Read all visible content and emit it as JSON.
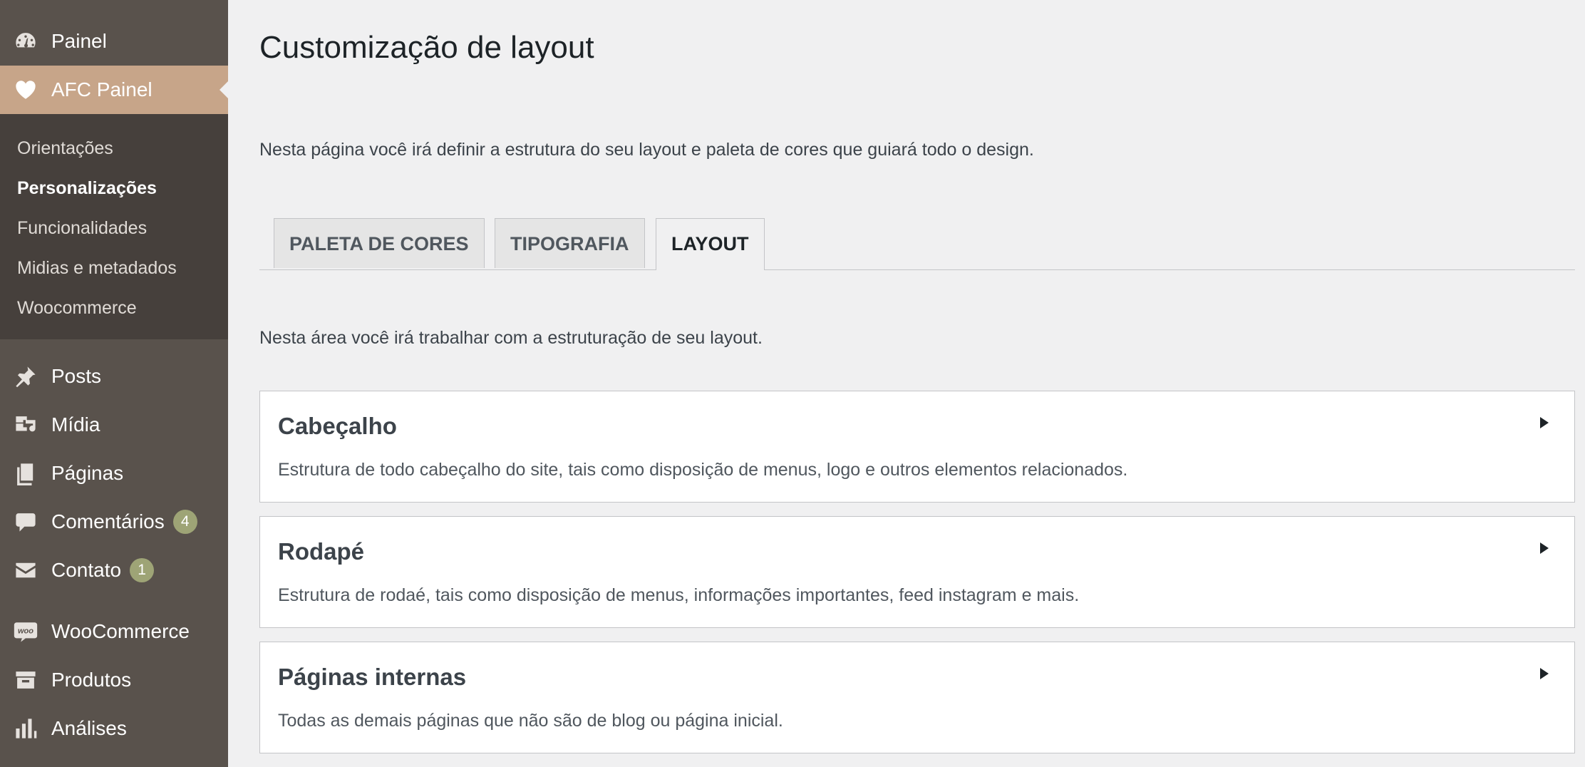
{
  "sidebar": {
    "top": [
      {
        "label": "Painel",
        "icon": "dashboard-icon"
      },
      {
        "label": "AFC Painel",
        "icon": "heart-icon"
      }
    ],
    "submenu": [
      {
        "label": "Orientações"
      },
      {
        "label": "Personalizações"
      },
      {
        "label": "Funcionalidades"
      },
      {
        "label": "Midias e metadados"
      },
      {
        "label": "Woocommerce"
      }
    ],
    "items": [
      {
        "label": "Posts",
        "icon": "pin-icon"
      },
      {
        "label": "Mídia",
        "icon": "media-icon"
      },
      {
        "label": "Páginas",
        "icon": "pages-icon"
      },
      {
        "label": "Comentários",
        "icon": "comment-icon",
        "badge": "4"
      },
      {
        "label": "Contato",
        "icon": "mail-icon",
        "badge": "1"
      },
      {
        "label": "WooCommerce",
        "icon": "woo-icon"
      },
      {
        "label": "Produtos",
        "icon": "archive-icon"
      },
      {
        "label": "Análises",
        "icon": "chart-icon"
      }
    ]
  },
  "page": {
    "title": "Customização de layout",
    "intro": "Nesta página você irá definir a estrutura do seu layout e paleta de cores que guiará todo o design.",
    "tabs": [
      {
        "label": "PALETA DE CORES"
      },
      {
        "label": "TIPOGRAFIA"
      },
      {
        "label": "LAYOUT"
      }
    ],
    "area_intro": "Nesta área você irá trabalhar com a estruturação de seu layout.",
    "sections": [
      {
        "title": "Cabeçalho",
        "description": "Estrutura de todo cabeçalho do site, tais como disposição de menus, logo e outros elementos relacionados."
      },
      {
        "title": "Rodapé",
        "description": "Estrutura de rodaé, tais como disposição de menus, informações importantes, feed instagram e mais."
      },
      {
        "title": "Páginas internas",
        "description": "Todas as demais páginas que não são de blog ou página inicial."
      }
    ]
  },
  "colors": {
    "sidebar_bg": "#59524c",
    "submenu_bg": "#46403c",
    "accent": "#c7a589",
    "badge": "#9ea476"
  }
}
